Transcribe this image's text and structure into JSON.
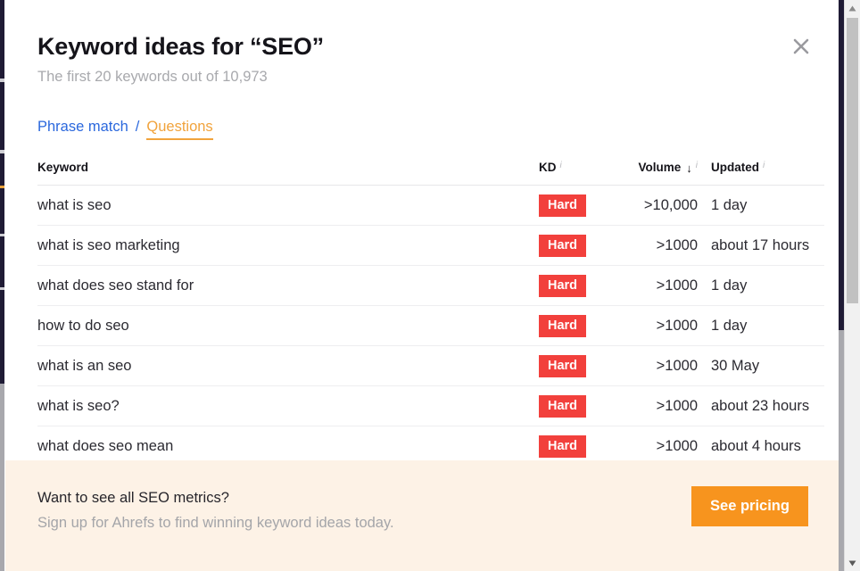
{
  "modal": {
    "title": "Keyword ideas for “SEO”",
    "subtitle": "The first 20 keywords out of 10,973",
    "close_icon": "close-icon"
  },
  "tabs": {
    "phrase_match": "Phrase match",
    "separator": "/",
    "questions": "Questions",
    "active": "Questions"
  },
  "table": {
    "columns": {
      "keyword": "Keyword",
      "kd": "KD",
      "volume": "Volume",
      "updated": "Updated"
    },
    "sort": {
      "column": "Volume",
      "direction": "desc",
      "arrow_glyph": "↓"
    },
    "info_glyph": "i",
    "rows": [
      {
        "keyword": "what is seo",
        "kd": "Hard",
        "volume": ">10,000",
        "updated": "1 day"
      },
      {
        "keyword": "what is seo marketing",
        "kd": "Hard",
        "volume": ">1000",
        "updated": "about 17 hours"
      },
      {
        "keyword": "what does seo stand for",
        "kd": "Hard",
        "volume": ">1000",
        "updated": "1 day"
      },
      {
        "keyword": "how to do seo",
        "kd": "Hard",
        "volume": ">1000",
        "updated": "1 day"
      },
      {
        "keyword": "what is an seo",
        "kd": "Hard",
        "volume": ">1000",
        "updated": "30 May"
      },
      {
        "keyword": "what is seo?",
        "kd": "Hard",
        "volume": ">1000",
        "updated": "about 23 hours"
      },
      {
        "keyword": "what does seo mean",
        "kd": "Hard",
        "volume": ">1000",
        "updated": "about 4 hours"
      }
    ]
  },
  "cta": {
    "title": "Want to see all SEO metrics?",
    "subtitle": "Sign up for Ahrefs to find winning keyword ideas today.",
    "button": "See pricing"
  },
  "colors": {
    "kd_hard": "#f2403c",
    "accent_orange": "#f7941e",
    "tab_link_blue": "#2b68dd",
    "tab_active_orange": "#f1a33c",
    "cta_background": "#fdf2e6"
  },
  "scrollbar": {
    "up_arrow": "▲",
    "down_arrow": "▼"
  }
}
